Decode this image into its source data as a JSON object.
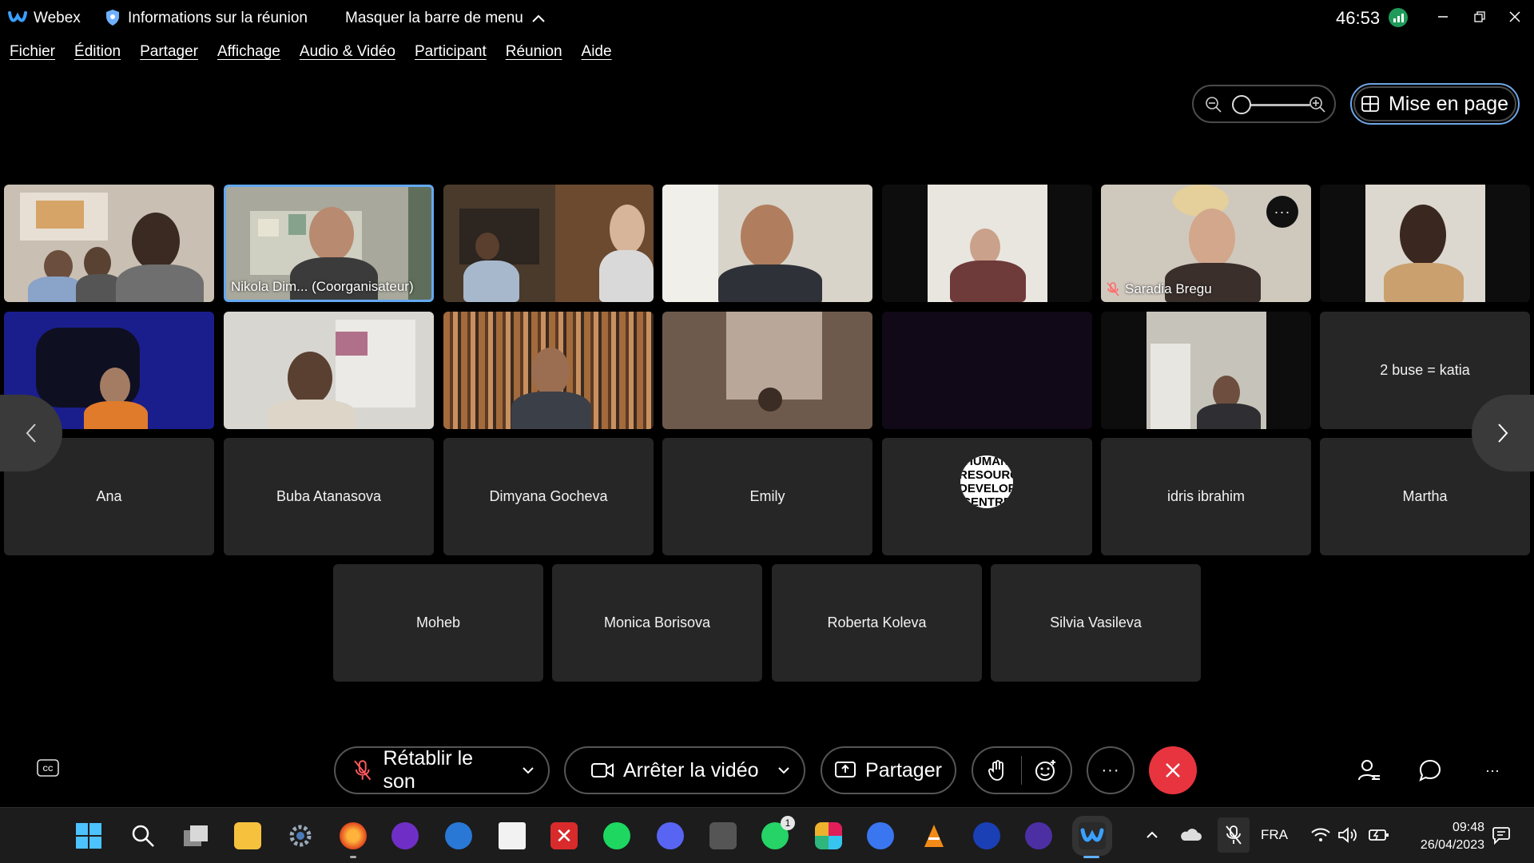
{
  "titlebar": {
    "app_name": "Webex",
    "meeting_info": "Informations sur la réunion",
    "hide_menu": "Masquer la barre de menu",
    "timer": "46:53"
  },
  "menu": [
    "Fichier",
    "Édition",
    "Partager",
    "Affichage",
    "Audio & Vidéo",
    "Participant",
    "Réunion",
    "Aide"
  ],
  "layout_button": "Mise en page",
  "video_tiles": [
    {
      "label": ""
    },
    {
      "label": "Nikola Dim... (Coorganisateur)"
    },
    {
      "label": ""
    },
    {
      "label": ""
    },
    {
      "label": ""
    },
    {
      "label": "Saradia Bregu"
    },
    {
      "label": ""
    },
    {
      "label": ""
    },
    {
      "label": ""
    },
    {
      "label": ""
    },
    {
      "label": ""
    },
    {
      "label": ""
    },
    {
      "label": ""
    },
    {
      "label": "2 buse = katia"
    }
  ],
  "name_tiles_row3": [
    "Ana",
    "Buba Atanasova",
    "Dimyana Gocheva",
    "Emily",
    "",
    "idris ibrahim",
    "Martha"
  ],
  "avatar_text": "HUMAN RESOURCE DEVELOP CENTRE",
  "name_tiles_row4": [
    "Moheb",
    "Monica Borisova",
    "Roberta Koleva",
    "Silvia Vasileva"
  ],
  "controls": {
    "unmute": "Rétablir le son",
    "stop_video": "Arrêter la vidéo",
    "share": "Partager"
  },
  "taskbar": {
    "whatsapp_badge": "1",
    "language": "FRA",
    "time": "09:48",
    "date": "26/04/2023"
  },
  "colors": {
    "accent_blue": "#64a8f0",
    "end_call_red": "#e8343f",
    "tile_gray": "#262626"
  }
}
